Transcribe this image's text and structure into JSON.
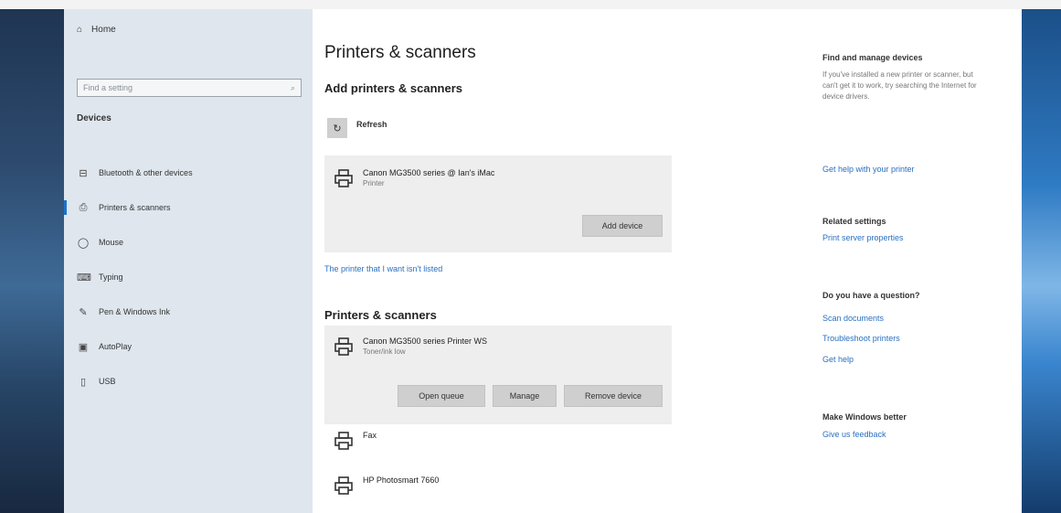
{
  "sidebar": {
    "home_label": "Home",
    "search_placeholder": "Find a setting",
    "section_title": "Devices",
    "items": [
      {
        "label": "Bluetooth & other devices",
        "icon": "bluetooth-devices-icon"
      },
      {
        "label": "Printers & scanners",
        "icon": "printer-icon",
        "active": true
      },
      {
        "label": "Mouse",
        "icon": "mouse-icon"
      },
      {
        "label": "Typing",
        "icon": "keyboard-icon"
      },
      {
        "label": "Pen & Windows Ink",
        "icon": "pen-icon"
      },
      {
        "label": "AutoPlay",
        "icon": "autoplay-icon"
      },
      {
        "label": "USB",
        "icon": "usb-icon"
      }
    ]
  },
  "main": {
    "title": "Printers & scanners",
    "add_section_title": "Add printers & scanners",
    "refresh_label": "Refresh",
    "found_printer": {
      "name": "Canon MG3500 series @ Ian's iMac",
      "status": "Printer",
      "add_button": "Add device"
    },
    "not_listed_link": "The printer that I want isn't listed",
    "list_section_title": "Printers & scanners",
    "selected_printer": {
      "name": "Canon MG3500 series Printer WS",
      "status": "Toner/ink low",
      "buttons": [
        "Open queue",
        "Manage",
        "Remove device"
      ]
    },
    "other_printers": [
      "Fax",
      "HP Photosmart 7660"
    ]
  },
  "right": {
    "find_heading": "Find and manage devices",
    "find_text": "If you've installed a new printer or scanner, but can't get it to work, try searching the Internet for device drivers.",
    "find_link": "Get help with your printer",
    "related_heading": "Related settings",
    "related_link": "Print server properties",
    "question_heading": "Do you have a question?",
    "question_links": [
      "Scan documents",
      "Troubleshoot printers",
      "Get help"
    ],
    "better_heading": "Make Windows better",
    "better_link": "Give us feedback"
  },
  "colors": {
    "sidebar_bg": "#dfe6ee",
    "accent": "#1a73c8",
    "link": "#2a6fc1",
    "panel_bg": "#eeeeee",
    "button_bg": "#cfcfcf"
  }
}
